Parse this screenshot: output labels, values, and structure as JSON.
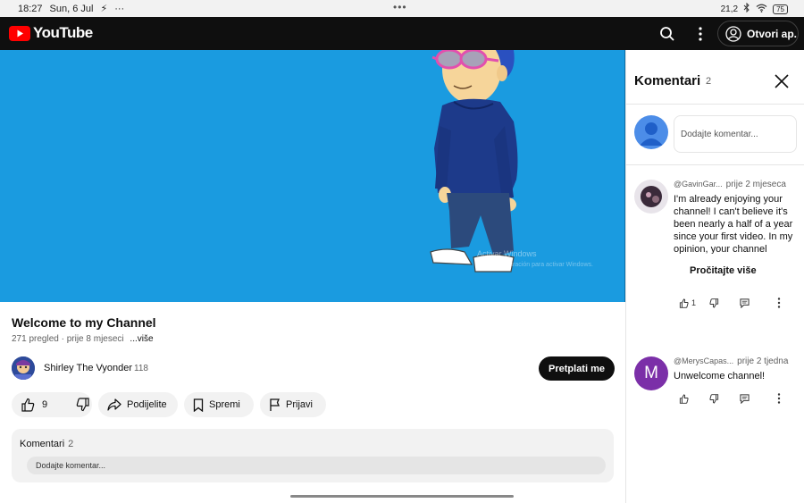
{
  "status_bar": {
    "time": "18:27",
    "date": "Sun, 6 Jul",
    "dots": "•••",
    "net_speed": "21,2",
    "battery": "75"
  },
  "header": {
    "logo_text": "YouTube",
    "open_app_label": "Otvori ap."
  },
  "video": {
    "title": "Welcome to my Channel",
    "views": "271 pregled",
    "age": "prije 8 mjeseci",
    "more_label": "...više",
    "watermark_line1": "Activar Windows",
    "watermark_line2": "Ve a Configuración para activar Windows."
  },
  "channel": {
    "name": "Shirley The Vyonder",
    "subscribers": "118",
    "subscribe_label": "Pretplati me"
  },
  "actions": {
    "likes": "9",
    "share_label": "Podijelite",
    "save_label": "Spremi",
    "report_label": "Prijavi"
  },
  "comments_box": {
    "title": "Komentari",
    "count": "2",
    "placeholder": "Dodajte komentar..."
  },
  "comments_panel": {
    "title": "Komentari",
    "count": "2",
    "add_placeholder": "Dodajte komentar...",
    "read_more_label": "Pročitajte više",
    "comments": [
      {
        "author": "@GavinGar...",
        "time": "prije 2 mjeseca",
        "text": "I'm already enjoying your channel! I can't believe it's been nearly a half of a year since your first video. In my opinion, your channel",
        "likes": "1"
      },
      {
        "author": "@MerysCapas...",
        "time": "prije 2 tjedna",
        "avatar_letter": "M",
        "text": "Unwelcome channel!",
        "likes": ""
      }
    ]
  }
}
